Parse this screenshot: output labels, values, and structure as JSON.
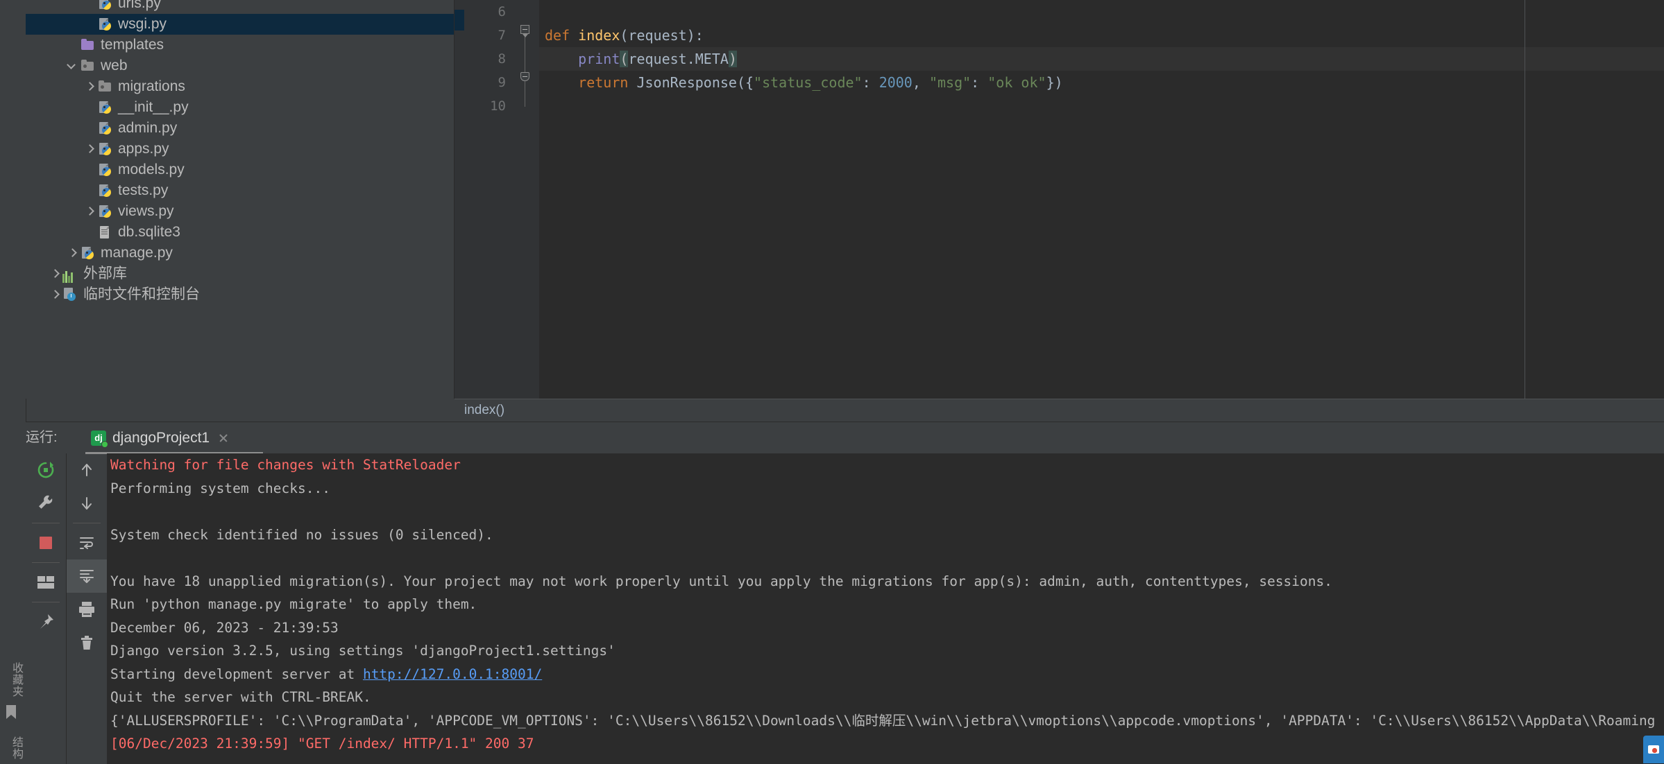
{
  "left_strip": {
    "favorites_label": "收藏夹",
    "structure_label": "结构",
    "bookmark_icon": "bookmark-icon"
  },
  "project_tree": {
    "items": [
      {
        "label": "urls.py",
        "icon": "python-file-icon",
        "indent": 3,
        "arrow": "none",
        "selected": false
      },
      {
        "label": "wsgi.py",
        "icon": "python-file-icon",
        "indent": 3,
        "arrow": "none",
        "selected": true
      },
      {
        "label": "templates",
        "icon": "folder-icon-purple",
        "indent": 2,
        "arrow": "none",
        "selected": false
      },
      {
        "label": "web",
        "icon": "folder-icon",
        "indent": 2,
        "arrow": "expanded",
        "selected": false
      },
      {
        "label": "migrations",
        "icon": "folder-icon",
        "indent": 3,
        "arrow": "collapsed",
        "selected": false
      },
      {
        "label": "__init__.py",
        "icon": "python-file-icon",
        "indent": 3,
        "arrow": "none",
        "selected": false
      },
      {
        "label": "admin.py",
        "icon": "python-file-icon",
        "indent": 3,
        "arrow": "none",
        "selected": false
      },
      {
        "label": "apps.py",
        "icon": "python-file-icon",
        "indent": 3,
        "arrow": "collapsed",
        "selected": false
      },
      {
        "label": "models.py",
        "icon": "python-file-icon",
        "indent": 3,
        "arrow": "none",
        "selected": false
      },
      {
        "label": "tests.py",
        "icon": "python-file-icon",
        "indent": 3,
        "arrow": "none",
        "selected": false
      },
      {
        "label": "views.py",
        "icon": "python-file-icon",
        "indent": 3,
        "arrow": "collapsed",
        "selected": false
      },
      {
        "label": "db.sqlite3",
        "icon": "sqlite-file-icon",
        "indent": 3,
        "arrow": "none",
        "selected": false
      },
      {
        "label": "manage.py",
        "icon": "python-file-icon",
        "indent": 2,
        "arrow": "collapsed",
        "selected": false
      },
      {
        "label": "外部库",
        "icon": "libraries-icon",
        "indent": 1,
        "arrow": "collapsed",
        "selected": false
      },
      {
        "label": "临时文件和控制台",
        "icon": "scratches-icon",
        "indent": 1,
        "arrow": "collapsed",
        "selected": false
      }
    ]
  },
  "editor": {
    "line_numbers": [
      "6",
      "7",
      "8",
      "9",
      "10"
    ],
    "breadcrumb": "index()",
    "code_lines": [
      {
        "n": "6",
        "current": false,
        "tokens": [
          {
            "t": "",
            "c": "txt"
          }
        ]
      },
      {
        "n": "7",
        "current": false,
        "tokens": [
          {
            "t": "def ",
            "c": "k"
          },
          {
            "t": "index",
            "c": "fn"
          },
          {
            "t": "(request):",
            "c": "txt"
          }
        ]
      },
      {
        "n": "8",
        "current": true,
        "tokens": [
          {
            "t": "    ",
            "c": "txt"
          },
          {
            "t": "print",
            "c": "pyfn"
          },
          {
            "t": "(",
            "c": "mhl"
          },
          {
            "t": "request.META",
            "c": "txt"
          },
          {
            "t": ")",
            "c": "mhl"
          }
        ]
      },
      {
        "n": "9",
        "current": false,
        "tokens": [
          {
            "t": "    ",
            "c": "txt"
          },
          {
            "t": "return ",
            "c": "k"
          },
          {
            "t": "JsonResponse({",
            "c": "txt"
          },
          {
            "t": "\"status_code\"",
            "c": "str"
          },
          {
            "t": ": ",
            "c": "txt"
          },
          {
            "t": "2000",
            "c": "num"
          },
          {
            "t": ", ",
            "c": "txt"
          },
          {
            "t": "\"msg\"",
            "c": "str"
          },
          {
            "t": ": ",
            "c": "txt"
          },
          {
            "t": "\"ok ok\"",
            "c": "str"
          },
          {
            "t": "})",
            "c": "txt"
          }
        ]
      },
      {
        "n": "10",
        "current": false,
        "tokens": [
          {
            "t": "",
            "c": "txt"
          }
        ]
      }
    ]
  },
  "run_panel": {
    "title": "运行:",
    "tab": {
      "icon_text": "dj",
      "name": "djangoProject1",
      "close_icon": "close-icon",
      "status": "running"
    },
    "toolbar_left": [
      "rerun-icon",
      "settings-wrench-icon",
      "stop-icon",
      "layout-icon",
      "pin-icon"
    ],
    "toolbar_right": [
      "scroll-up-icon",
      "scroll-down-icon",
      "soft-wrap-icon",
      "scroll-to-end-icon",
      "print-icon",
      "clear-all-icon"
    ],
    "console_lines": [
      {
        "text": "Watching for file changes with StatReloader",
        "error": true
      },
      {
        "text": "Performing system checks...",
        "error": false
      },
      {
        "text": "",
        "error": false
      },
      {
        "text": "System check identified no issues (0 silenced).",
        "error": false
      },
      {
        "text": "",
        "error": false
      },
      {
        "text": "You have 18 unapplied migration(s). Your project may not work properly until you apply the migrations for app(s): admin, auth, contenttypes, sessions.",
        "error": false
      },
      {
        "text": "Run 'python manage.py migrate' to apply them.",
        "error": false
      },
      {
        "text": "December 06, 2023 - 21:39:53",
        "error": false
      },
      {
        "text": "Django version 3.2.5, using settings 'djangoProject1.settings'",
        "error": false
      },
      {
        "text": "Starting development server at ",
        "error": false,
        "link": "http://127.0.0.1:8001/"
      },
      {
        "text": "Quit the server with CTRL-BREAK.",
        "error": false
      },
      {
        "text": "{'ALLUSERSPROFILE': 'C:\\\\ProgramData', 'APPCODE_VM_OPTIONS': 'C:\\\\Users\\\\86152\\\\Downloads\\\\临时解压\\\\win\\\\jetbra\\\\vmoptions\\\\appcode.vmoptions', 'APPDATA': 'C:\\\\Users\\\\86152\\\\AppData\\\\Roaming",
        "error": false
      },
      {
        "text": "[06/Dec/2023 21:39:59] \"GET /index/ HTTP/1.1\" 200 37",
        "error": true
      }
    ]
  },
  "colors": {
    "background": "#3c3f41",
    "editor_background": "#2b2b2b",
    "selection": "#0d293e",
    "error_text": "#ff6b68",
    "link": "#589df6",
    "keyword": "#cc7832",
    "string": "#6a8759",
    "number": "#6897bb",
    "function": "#ffc66d"
  }
}
